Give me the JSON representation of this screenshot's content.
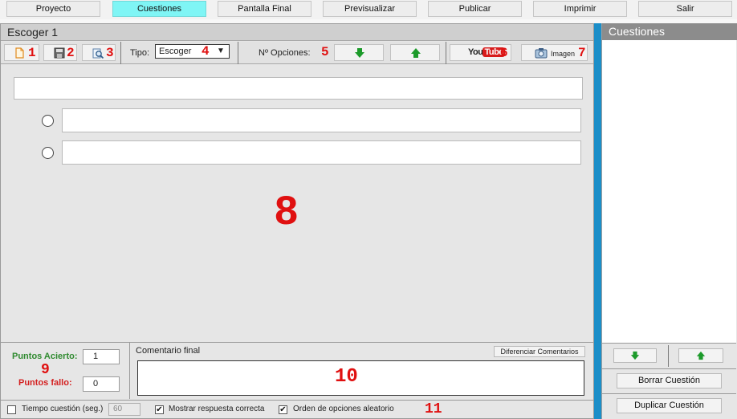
{
  "menu": {
    "items": [
      {
        "label": "Proyecto"
      },
      {
        "label": "Cuestiones",
        "active": true
      },
      {
        "label": "Pantalla Final"
      },
      {
        "label": "Previsualizar"
      },
      {
        "label": "Publicar"
      },
      {
        "label": "Imprimir"
      },
      {
        "label": "Salir"
      }
    ]
  },
  "editor": {
    "title": "Escoger 1",
    "toolbar": {
      "marker_new": "1",
      "marker_save": "2",
      "marker_preview": "3",
      "tipo_label": "Tipo:",
      "tipo_value": "Escoger",
      "tipo_arrow": "▼",
      "marker_tipo": "4",
      "num_opciones_label": "Nº Opciones:",
      "marker_opciones": "5",
      "youtube_you": "You",
      "youtube_tube": "Tube",
      "marker_youtube": "6",
      "imagen_label": "Imagen",
      "marker_imagen": "7"
    },
    "question_text": "",
    "options": [
      {
        "text": ""
      },
      {
        "text": ""
      }
    ],
    "marker_area": "8",
    "scoring": {
      "puntos_acierto_label": "Puntos Acierto:",
      "puntos_acierto_value": "1",
      "puntos_fallo_label": "Puntos fallo:",
      "puntos_fallo_value": "0",
      "marker": "9"
    },
    "comment": {
      "label": "Comentario final",
      "diferenciar_button": "Diferenciar Comentarios",
      "text": "",
      "marker": "10"
    },
    "footer": {
      "tiempo_label": "Tiempo cuestión (seg.)",
      "tiempo_value": "60",
      "tiempo_checked": false,
      "mostrar_label": "Mostrar respuesta correcta",
      "mostrar_checked": true,
      "orden_label": "Orden de opciones aleatorio",
      "orden_checked": true,
      "marker": "11"
    }
  },
  "sidebar": {
    "title": "Cuestiones",
    "borrar_button": "Borrar Cuestión",
    "duplicar_button": "Duplicar Cuestión"
  },
  "colors": {
    "active_menu": "#7ff5f5",
    "annotation_red": "#e01010",
    "arrow_green": "#1c9a2a",
    "sidebar_strip_blue": "#1b8ec8",
    "puntos_acierto_green": "#2f8a2f",
    "puntos_fallo_red": "#d42020"
  },
  "icons": {
    "new": "new-document-icon",
    "save": "save-disk-icon",
    "preview": "magnifier-preview-icon",
    "down": "arrow-down-icon",
    "up": "arrow-up-icon",
    "camera": "camera-icon"
  }
}
